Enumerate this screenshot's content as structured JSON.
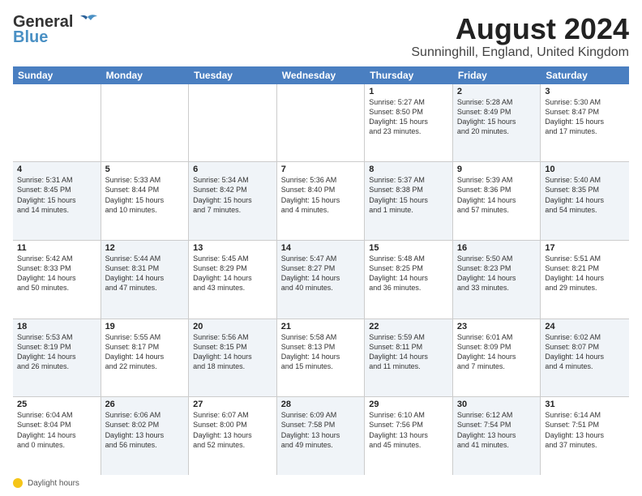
{
  "header": {
    "logo_line1": "General",
    "logo_line2": "Blue",
    "title": "August 2024",
    "subtitle": "Sunninghill, England, United Kingdom"
  },
  "days_of_week": [
    "Sunday",
    "Monday",
    "Tuesday",
    "Wednesday",
    "Thursday",
    "Friday",
    "Saturday"
  ],
  "footnote": "Daylight hours",
  "weeks": [
    [
      {
        "day": "",
        "info": "",
        "shaded": false
      },
      {
        "day": "",
        "info": "",
        "shaded": true
      },
      {
        "day": "",
        "info": "",
        "shaded": false
      },
      {
        "day": "",
        "info": "",
        "shaded": true
      },
      {
        "day": "1",
        "info": "Sunrise: 5:27 AM\nSunset: 8:50 PM\nDaylight: 15 hours\nand 23 minutes.",
        "shaded": false
      },
      {
        "day": "2",
        "info": "Sunrise: 5:28 AM\nSunset: 8:49 PM\nDaylight: 15 hours\nand 20 minutes.",
        "shaded": true
      },
      {
        "day": "3",
        "info": "Sunrise: 5:30 AM\nSunset: 8:47 PM\nDaylight: 15 hours\nand 17 minutes.",
        "shaded": false
      }
    ],
    [
      {
        "day": "4",
        "info": "Sunrise: 5:31 AM\nSunset: 8:45 PM\nDaylight: 15 hours\nand 14 minutes.",
        "shaded": true
      },
      {
        "day": "5",
        "info": "Sunrise: 5:33 AM\nSunset: 8:44 PM\nDaylight: 15 hours\nand 10 minutes.",
        "shaded": false
      },
      {
        "day": "6",
        "info": "Sunrise: 5:34 AM\nSunset: 8:42 PM\nDaylight: 15 hours\nand 7 minutes.",
        "shaded": true
      },
      {
        "day": "7",
        "info": "Sunrise: 5:36 AM\nSunset: 8:40 PM\nDaylight: 15 hours\nand 4 minutes.",
        "shaded": false
      },
      {
        "day": "8",
        "info": "Sunrise: 5:37 AM\nSunset: 8:38 PM\nDaylight: 15 hours\nand 1 minute.",
        "shaded": true
      },
      {
        "day": "9",
        "info": "Sunrise: 5:39 AM\nSunset: 8:36 PM\nDaylight: 14 hours\nand 57 minutes.",
        "shaded": false
      },
      {
        "day": "10",
        "info": "Sunrise: 5:40 AM\nSunset: 8:35 PM\nDaylight: 14 hours\nand 54 minutes.",
        "shaded": true
      }
    ],
    [
      {
        "day": "11",
        "info": "Sunrise: 5:42 AM\nSunset: 8:33 PM\nDaylight: 14 hours\nand 50 minutes.",
        "shaded": false
      },
      {
        "day": "12",
        "info": "Sunrise: 5:44 AM\nSunset: 8:31 PM\nDaylight: 14 hours\nand 47 minutes.",
        "shaded": true
      },
      {
        "day": "13",
        "info": "Sunrise: 5:45 AM\nSunset: 8:29 PM\nDaylight: 14 hours\nand 43 minutes.",
        "shaded": false
      },
      {
        "day": "14",
        "info": "Sunrise: 5:47 AM\nSunset: 8:27 PM\nDaylight: 14 hours\nand 40 minutes.",
        "shaded": true
      },
      {
        "day": "15",
        "info": "Sunrise: 5:48 AM\nSunset: 8:25 PM\nDaylight: 14 hours\nand 36 minutes.",
        "shaded": false
      },
      {
        "day": "16",
        "info": "Sunrise: 5:50 AM\nSunset: 8:23 PM\nDaylight: 14 hours\nand 33 minutes.",
        "shaded": true
      },
      {
        "day": "17",
        "info": "Sunrise: 5:51 AM\nSunset: 8:21 PM\nDaylight: 14 hours\nand 29 minutes.",
        "shaded": false
      }
    ],
    [
      {
        "day": "18",
        "info": "Sunrise: 5:53 AM\nSunset: 8:19 PM\nDaylight: 14 hours\nand 26 minutes.",
        "shaded": true
      },
      {
        "day": "19",
        "info": "Sunrise: 5:55 AM\nSunset: 8:17 PM\nDaylight: 14 hours\nand 22 minutes.",
        "shaded": false
      },
      {
        "day": "20",
        "info": "Sunrise: 5:56 AM\nSunset: 8:15 PM\nDaylight: 14 hours\nand 18 minutes.",
        "shaded": true
      },
      {
        "day": "21",
        "info": "Sunrise: 5:58 AM\nSunset: 8:13 PM\nDaylight: 14 hours\nand 15 minutes.",
        "shaded": false
      },
      {
        "day": "22",
        "info": "Sunrise: 5:59 AM\nSunset: 8:11 PM\nDaylight: 14 hours\nand 11 minutes.",
        "shaded": true
      },
      {
        "day": "23",
        "info": "Sunrise: 6:01 AM\nSunset: 8:09 PM\nDaylight: 14 hours\nand 7 minutes.",
        "shaded": false
      },
      {
        "day": "24",
        "info": "Sunrise: 6:02 AM\nSunset: 8:07 PM\nDaylight: 14 hours\nand 4 minutes.",
        "shaded": true
      }
    ],
    [
      {
        "day": "25",
        "info": "Sunrise: 6:04 AM\nSunset: 8:04 PM\nDaylight: 14 hours\nand 0 minutes.",
        "shaded": false
      },
      {
        "day": "26",
        "info": "Sunrise: 6:06 AM\nSunset: 8:02 PM\nDaylight: 13 hours\nand 56 minutes.",
        "shaded": true
      },
      {
        "day": "27",
        "info": "Sunrise: 6:07 AM\nSunset: 8:00 PM\nDaylight: 13 hours\nand 52 minutes.",
        "shaded": false
      },
      {
        "day": "28",
        "info": "Sunrise: 6:09 AM\nSunset: 7:58 PM\nDaylight: 13 hours\nand 49 minutes.",
        "shaded": true
      },
      {
        "day": "29",
        "info": "Sunrise: 6:10 AM\nSunset: 7:56 PM\nDaylight: 13 hours\nand 45 minutes.",
        "shaded": false
      },
      {
        "day": "30",
        "info": "Sunrise: 6:12 AM\nSunset: 7:54 PM\nDaylight: 13 hours\nand 41 minutes.",
        "shaded": true
      },
      {
        "day": "31",
        "info": "Sunrise: 6:14 AM\nSunset: 7:51 PM\nDaylight: 13 hours\nand 37 minutes.",
        "shaded": false
      }
    ]
  ]
}
